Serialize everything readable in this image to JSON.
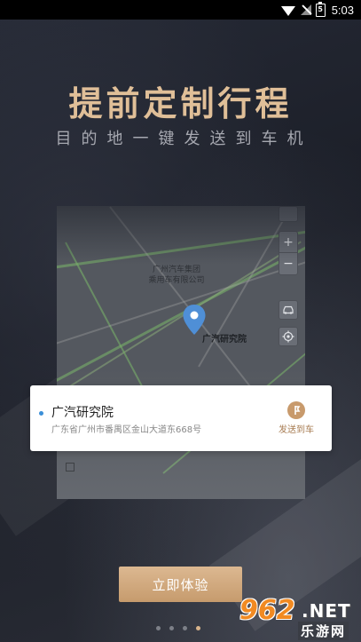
{
  "status_bar": {
    "time": "5:03",
    "battery_level": "5",
    "icons": [
      "wifi-icon",
      "no-signal-icon",
      "battery-icon"
    ]
  },
  "heading": {
    "title": "提前定制行程",
    "subtitle": "目的地一键发送到车机"
  },
  "map": {
    "company_label_line1": "广州汽车集团",
    "company_label_line2": "乘用车有限公司",
    "pin_label": "广汽研究院",
    "zoom_in": "+",
    "zoom_out": "−",
    "icons": [
      "car-icon",
      "locate-icon",
      "map-pin-icon"
    ]
  },
  "card": {
    "title": "广汽研究院",
    "address": "广东省广州市番禺区金山大道东668号",
    "send_label": "发送到车"
  },
  "cta": {
    "label": "立即体验"
  },
  "pager": {
    "count": 4,
    "active_index": 3
  },
  "watermark": {
    "number": "962",
    "suffix": ".NET",
    "subtitle": "乐游网"
  },
  "colors": {
    "accent_gold": "#e0bf98",
    "button_gold": "#c69b6d",
    "dot_blue": "#3b8fd8"
  }
}
